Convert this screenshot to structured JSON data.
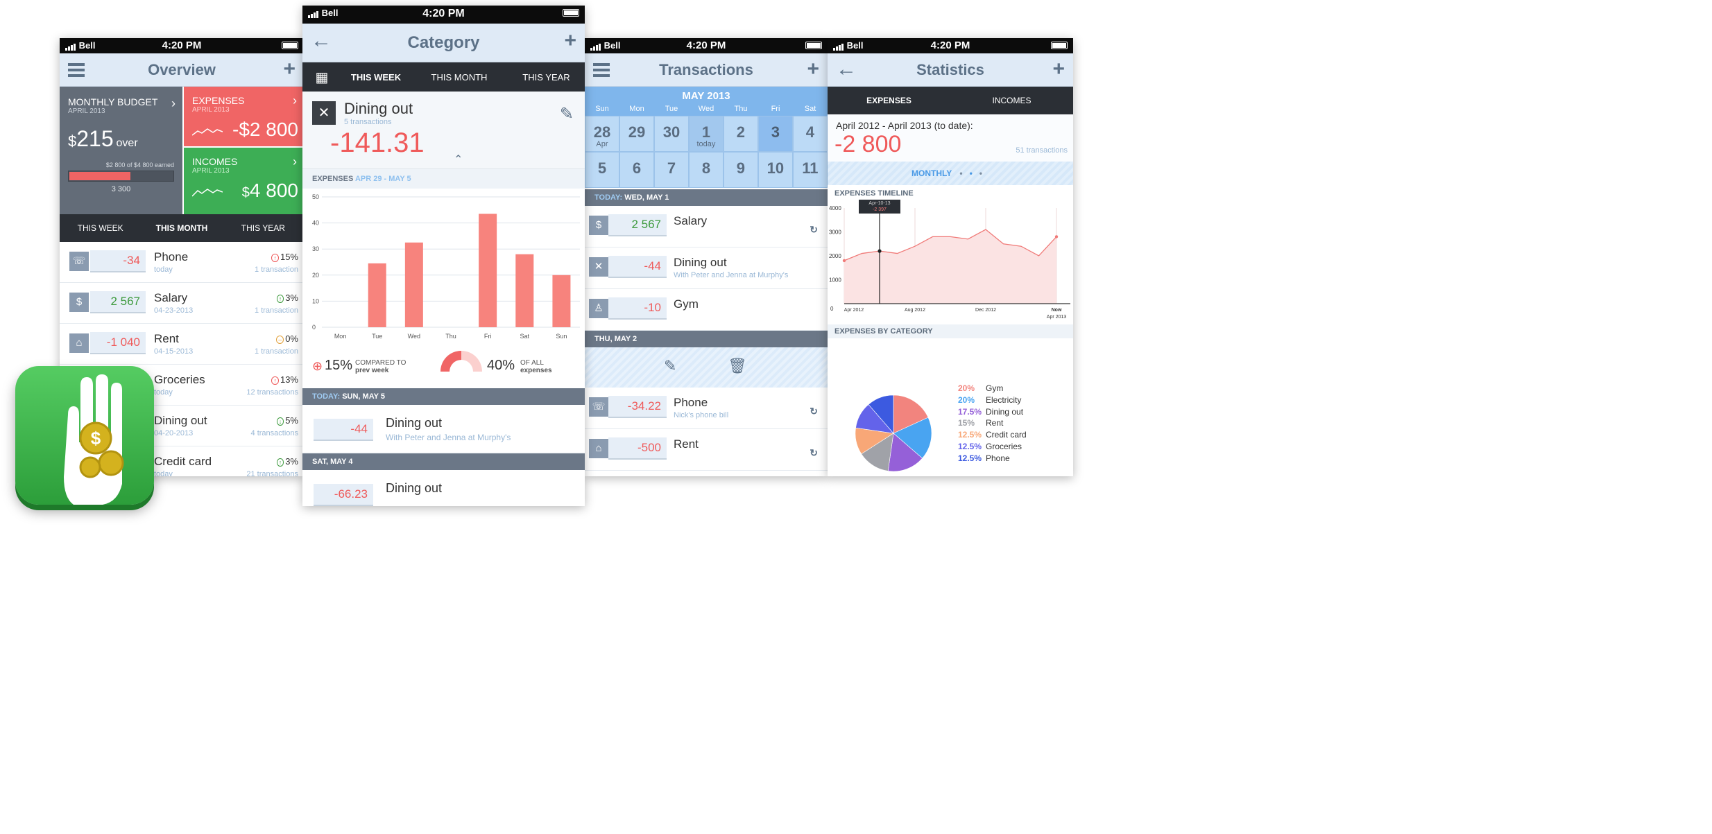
{
  "status": {
    "carrier": "Bell",
    "time": "4:20 PM"
  },
  "overview": {
    "title": "Overview",
    "budget": {
      "label": "MONTHLY BUDGET",
      "date": "APRIL 2013",
      "amount": "215",
      "currency": "$",
      "suffix": "over",
      "earned_text": "$2 800 of $4 800 earned",
      "total": "3 300",
      "fill": 0.58
    },
    "expenses": {
      "label": "EXPENSES",
      "date": "APRIL 2013",
      "amount": "-$2 800"
    },
    "incomes": {
      "label": "INCOMES",
      "date": "APRIL 2013",
      "currency": "$",
      "amount": "4 800"
    },
    "tabs": [
      "THIS WEEK",
      "THIS MONTH",
      "THIS YEAR"
    ],
    "items": [
      {
        "icon": "☏",
        "amount": "-34",
        "name": "Phone",
        "date": "today",
        "pct": "15%",
        "arrow": "↑",
        "arrow_color": "#ef5a5a",
        "tx": "1 transaction",
        "kind": "neg"
      },
      {
        "icon": "$",
        "amount": "2 567",
        "name": "Salary",
        "date": "04-23-2013",
        "pct": "3%",
        "arrow": "↑",
        "arrow_color": "#3d9a3d",
        "tx": "1 transaction",
        "kind": "pos"
      },
      {
        "icon": "⌂",
        "amount": "-1 040",
        "name": "Rent",
        "date": "04-15-2013",
        "pct": "0%",
        "arrow": "–",
        "arrow_color": "#e2a13a",
        "tx": "1 transaction",
        "kind": "neg"
      },
      {
        "icon": "🛒",
        "amount": "",
        "name": "Groceries",
        "date": "today",
        "pct": "13%",
        "arrow": "↑",
        "arrow_color": "#ef5a5a",
        "tx": "12 transactions",
        "kind": "neg"
      },
      {
        "icon": "✕",
        "amount": "",
        "name": "Dining out",
        "date": "04-20-2013",
        "pct": "5%",
        "arrow": "↓",
        "arrow_color": "#3d9a3d",
        "tx": "4 transactions",
        "kind": "neg"
      },
      {
        "icon": "▭",
        "amount": "",
        "name": "Credit card",
        "date": "today",
        "pct": "3%",
        "arrow": "↑",
        "arrow_color": "#3d9a3d",
        "tx": "21 transactions",
        "kind": "neg"
      }
    ]
  },
  "category": {
    "title": "Category",
    "tabs": [
      "THIS WEEK",
      "THIS MONTH",
      "THIS YEAR"
    ],
    "name": "Dining out",
    "tx": "5 transactions",
    "amount": "-141.31",
    "chart_title": "EXPENSES",
    "chart_range": "APR 29 - MAY 5",
    "compare_pct": "15%",
    "compare_text1": "COMPARED TO",
    "compare_text2": "prev week",
    "share_pct": "40%",
    "share_text1": "OF ALL",
    "share_text2": "expenses",
    "today_label": "TODAY:",
    "today_date": "SUN, MAY 5",
    "item1": {
      "amount": "-44",
      "name": "Dining out",
      "note": "With Peter and Jenna at Murphy's"
    },
    "sat_label": "SAT, MAY 4",
    "item2": {
      "amount": "-66.23",
      "name": "Dining out"
    }
  },
  "chart_data": {
    "type": "bar",
    "categories": [
      "Mon",
      "Tue",
      "Wed",
      "Thu",
      "Fri",
      "Sat",
      "Sun"
    ],
    "values": [
      0,
      24.5,
      32.5,
      0,
      43.5,
      28,
      20
    ],
    "ylim": [
      0,
      50
    ],
    "yticks": [
      0,
      10,
      20,
      30,
      40,
      50
    ]
  },
  "transactions": {
    "title": "Transactions",
    "month": "MAY 2013",
    "weekdays": [
      "Sun",
      "Mon",
      "Tue",
      "Wed",
      "Thu",
      "Fri",
      "Sat"
    ],
    "days": [
      "28",
      "29",
      "30",
      "1",
      "2",
      "3",
      "4",
      "5",
      "6",
      "7",
      "8",
      "9",
      "10",
      "11"
    ],
    "day_sub": {
      "0": "Apr",
      "3": "today"
    },
    "today_label": "TODAY:",
    "today_date": "WED, MAY 1",
    "group1": [
      {
        "icon": "$",
        "amount": "2 567",
        "kind": "pos",
        "name": "Salary",
        "note": "",
        "repeat": true
      },
      {
        "icon": "✕",
        "amount": "-44",
        "kind": "neg",
        "name": "Dining out",
        "note": "With Peter and Jenna at Murphy's",
        "repeat": false
      },
      {
        "icon": "♙",
        "amount": "-10",
        "kind": "neg",
        "name": "Gym",
        "note": "",
        "repeat": false
      }
    ],
    "thu_label": "THU, MAY 2",
    "group2": [
      {
        "icon": "☏",
        "amount": "-34.22",
        "kind": "neg",
        "name": "Phone",
        "note": "Nick's phone bill",
        "repeat": true
      },
      {
        "icon": "⌂",
        "amount": "-500",
        "kind": "neg",
        "name": "Rent",
        "note": "",
        "repeat": true
      }
    ]
  },
  "statistics": {
    "title": "Statistics",
    "tabs": [
      "EXPENSES",
      "INCOMES"
    ],
    "range": "April 2012 - April 2013 (to date):",
    "amount": "-2 800",
    "tx": "51 transactions",
    "period": "MONTHLY",
    "timeline_title": "EXPENSES TIMELINE",
    "yticks": [
      "4000",
      "3000",
      "2000",
      "1000",
      "0"
    ],
    "xticks": [
      "Apr 2012",
      "Aug 2012",
      "Dec 2012",
      "Now"
    ],
    "xtick_extra": "Apr 2013",
    "tooltip_date": "Apr-10-13",
    "tooltip_val": "-2 397",
    "line_values": [
      1800,
      2100,
      2200,
      2100,
      2400,
      2800,
      2800,
      2700,
      3100,
      2500,
      2400,
      2000,
      2800
    ],
    "category_title": "EXPENSES BY CATEGORY",
    "categories": [
      {
        "pct": "20%",
        "name": "Gym",
        "color": "#f2847e"
      },
      {
        "pct": "20%",
        "name": "Electricity",
        "color": "#49a4f1"
      },
      {
        "pct": "17.5%",
        "name": "Dining out",
        "color": "#9560d8"
      },
      {
        "pct": "15%",
        "name": "Rent",
        "color": "#a0a2a8"
      },
      {
        "pct": "12.5%",
        "name": "Credit card",
        "color": "#f8a777"
      },
      {
        "pct": "12.5%",
        "name": "Groceries",
        "color": "#6363ea"
      },
      {
        "pct": "12.5%",
        "name": "Phone",
        "color": "#3c5ae0"
      }
    ],
    "pie": [
      20,
      20,
      17.5,
      15,
      12.5,
      12.5,
      12.5
    ]
  }
}
